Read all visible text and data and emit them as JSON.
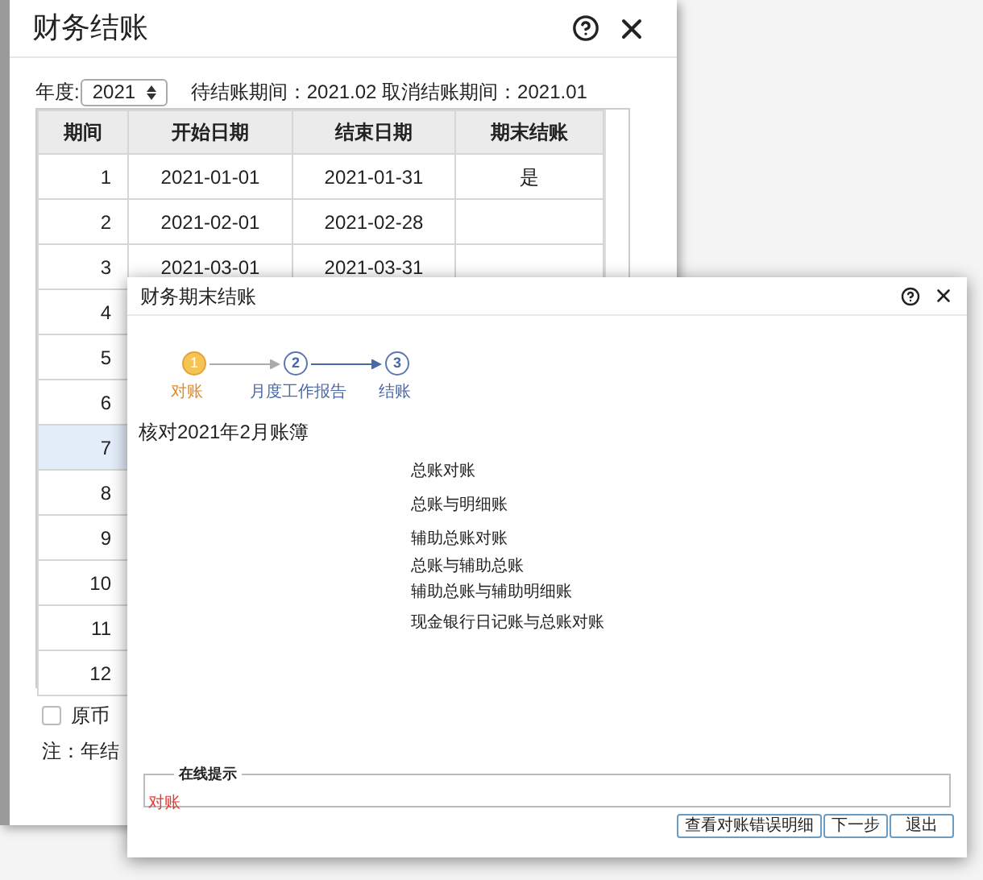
{
  "main_window": {
    "title": "财务结账",
    "year_label": "年度:",
    "year": "2021",
    "period_info": "待结账期间：2021.02 取消结账期间：2021.01",
    "columns": [
      "期间",
      "开始日期",
      "结束日期",
      "期末结账"
    ],
    "rows": [
      {
        "period": "1",
        "start": "2021-01-01",
        "end": "2021-01-31",
        "closed": "是",
        "selected": false
      },
      {
        "period": "2",
        "start": "2021-02-01",
        "end": "2021-02-28",
        "selected": false
      },
      {
        "period": "3",
        "start": "2021-03-01",
        "end": "2021-03-31",
        "selected": false
      },
      {
        "period": "4",
        "selected": false
      },
      {
        "period": "5",
        "selected": false
      },
      {
        "period": "6",
        "selected": false
      },
      {
        "period": "7",
        "selected": true
      },
      {
        "period": "8",
        "selected": false
      },
      {
        "period": "9",
        "selected": false
      },
      {
        "period": "10",
        "selected": false
      },
      {
        "period": "11",
        "selected": false
      },
      {
        "period": "12",
        "selected": false
      }
    ],
    "checkbox": {
      "label": "原币",
      "checked": false
    },
    "note": "注：年结"
  },
  "dialog": {
    "title": "财务期末结账",
    "steps": [
      {
        "number": "1",
        "label": "对账",
        "selected": true
      },
      {
        "number": "2",
        "label": "月度工作报告",
        "selected": false
      },
      {
        "number": "3",
        "label": "结账",
        "selected": false
      }
    ],
    "heading": "核对2021年2月账簿",
    "items": [
      "总账对账",
      "总账与明细账",
      "辅助总账对账",
      "总账与辅助总账",
      "辅助总账与辅助明细账",
      "现金银行日记账与总账对账"
    ],
    "hint": {
      "legend": "在线提示",
      "text": "对账"
    },
    "buttons": [
      "查看对账错误明细",
      "下一步",
      "退出"
    ]
  }
}
